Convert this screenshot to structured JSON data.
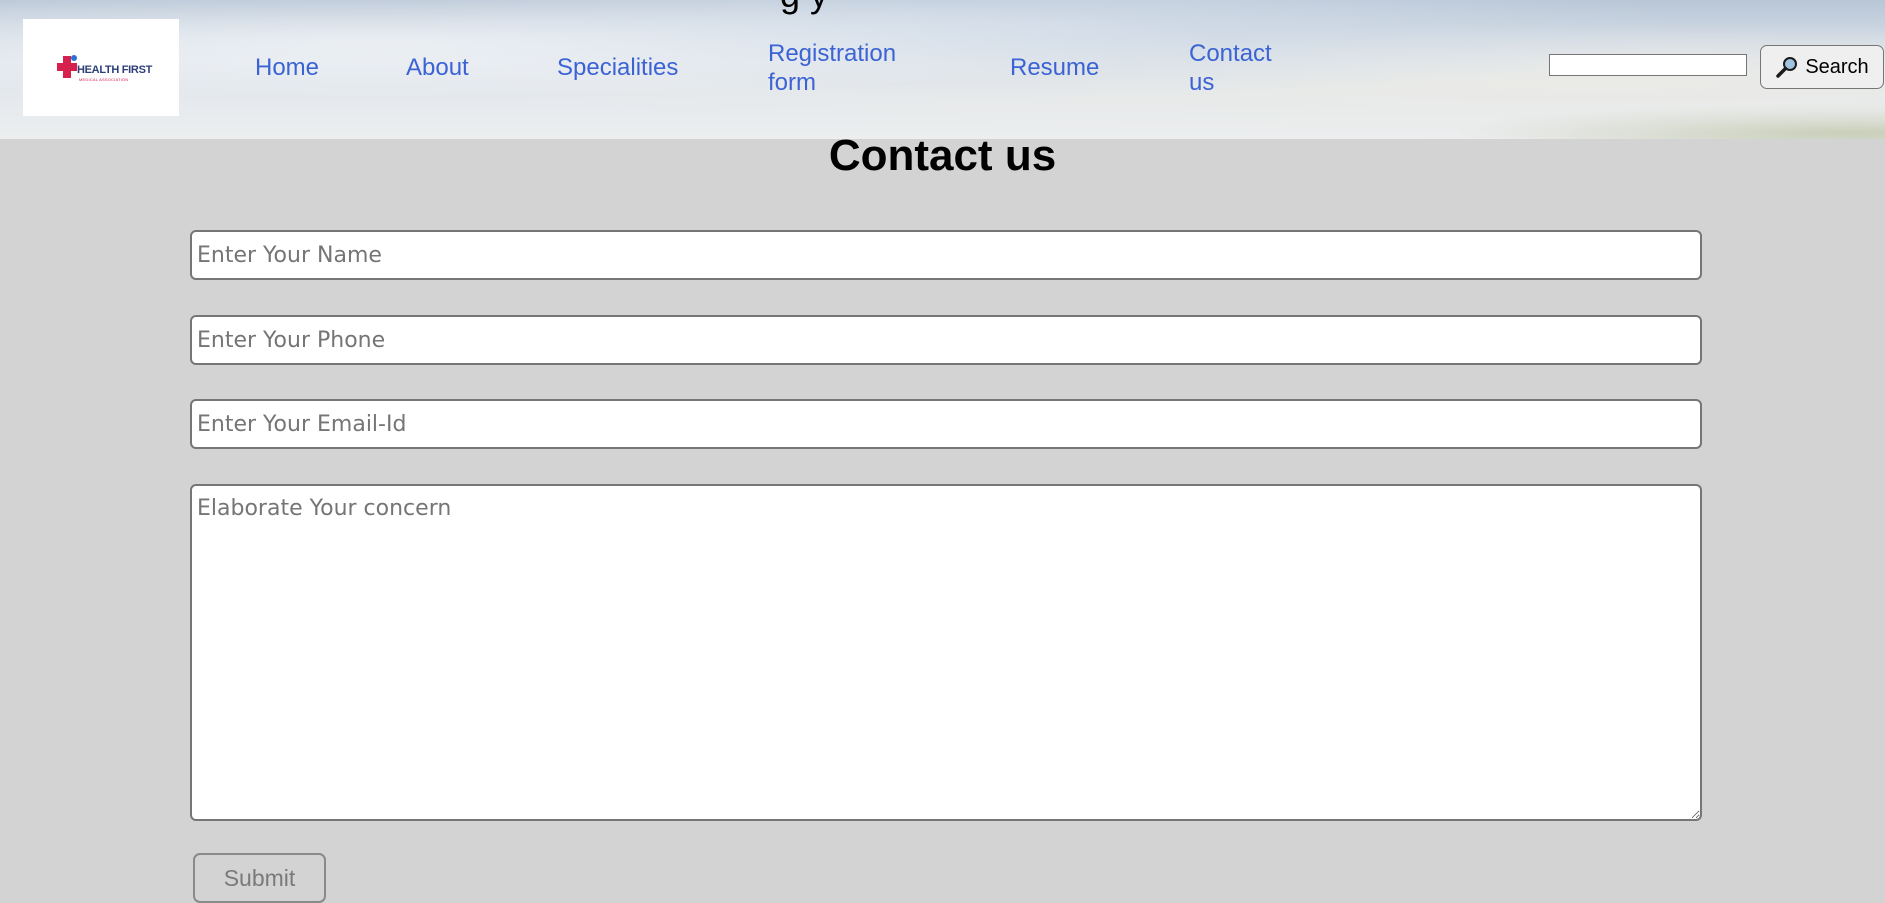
{
  "header": {
    "logo": {
      "brand": "HEALTH FIRST",
      "subtitle": "MEDICAL ASSOCIATION"
    },
    "nav": [
      {
        "label": "Home"
      },
      {
        "label": "About"
      },
      {
        "label": "Specialities"
      },
      {
        "label": "Registration form"
      },
      {
        "label": "Resume"
      },
      {
        "label": "Contact us"
      }
    ],
    "search": {
      "value": "",
      "button_label": "Search",
      "icon": "magnifier-icon"
    }
  },
  "main": {
    "title": "Contact us",
    "fields": {
      "name_placeholder": "Enter Your Name",
      "phone_placeholder": "Enter Your Phone",
      "email_placeholder": "Enter Your Email-Id",
      "concern_placeholder": "Elaborate Your concern"
    },
    "submit_label": "Submit"
  },
  "colors": {
    "nav_link": "#3b63d4",
    "page_background": "#d3d3d3",
    "logo_cross": "#d4214e"
  }
}
